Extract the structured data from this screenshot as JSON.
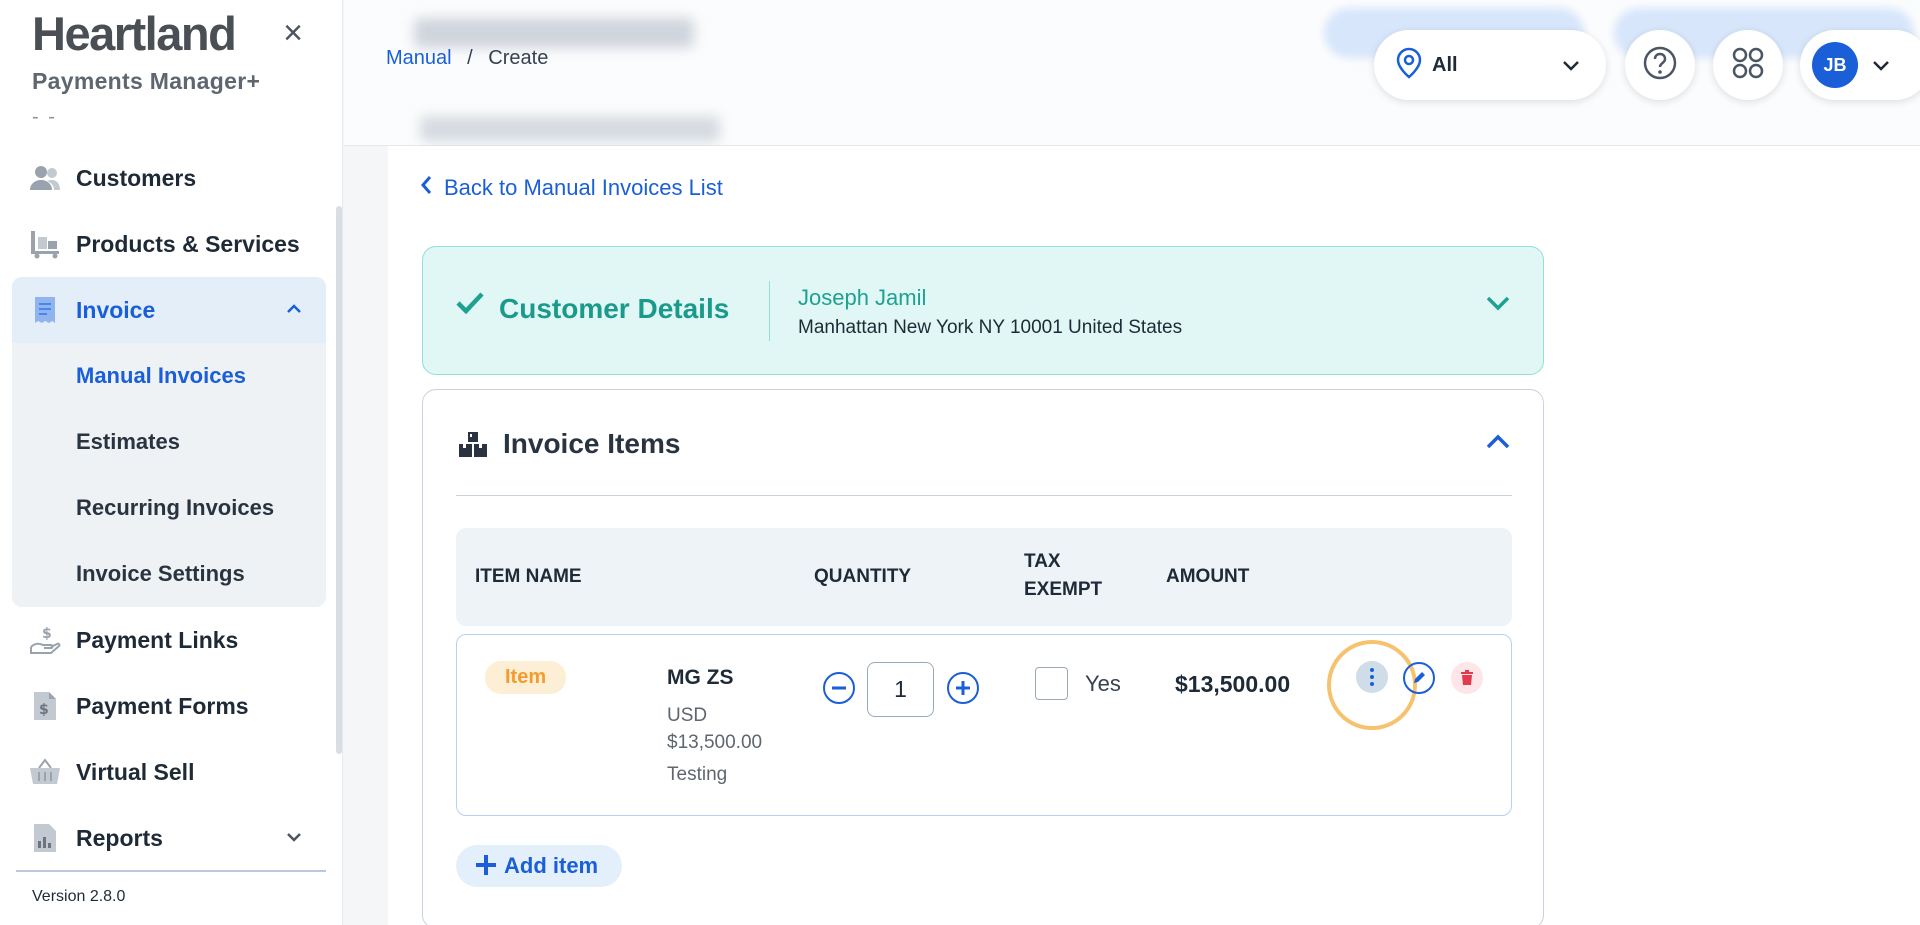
{
  "brand": {
    "name": "Heartland",
    "subtitle": "Payments Manager+",
    "dashes": "- -"
  },
  "sidebar": {
    "items": [
      {
        "label": "Customers",
        "icon": "users-icon"
      },
      {
        "label": "Products & Services",
        "icon": "products-icon"
      },
      {
        "label": "Invoice",
        "icon": "receipt-icon",
        "expanded": true,
        "children": [
          {
            "label": "Manual Invoices",
            "current": true
          },
          {
            "label": "Estimates"
          },
          {
            "label": "Recurring Invoices"
          },
          {
            "label": "Invoice Settings"
          }
        ]
      },
      {
        "label": "Payment Links",
        "icon": "hand-dollar-icon"
      },
      {
        "label": "Payment Forms",
        "icon": "dollar-document-icon"
      },
      {
        "label": "Virtual Sell",
        "icon": "basket-icon"
      },
      {
        "label": "Reports",
        "icon": "report-icon"
      }
    ],
    "version": "Version 2.8.0"
  },
  "breadcrumb": {
    "link": "Manual",
    "separator": "/",
    "current": "Create"
  },
  "header": {
    "location_label": "All",
    "avatar_initials": "JB"
  },
  "back_link": "Back to Manual Invoices List",
  "customer": {
    "title": "Customer Details",
    "name": "Joseph Jamil",
    "address": "Manhattan New York NY 10001 United States"
  },
  "invoice_items": {
    "title": "Invoice Items",
    "columns": [
      "ITEM NAME",
      "QUANTITY",
      "TAX EXEMPT",
      "AMOUNT"
    ],
    "rows": [
      {
        "type_badge": "Item",
        "name": "MG ZS",
        "currency": "USD",
        "price": "$13,500.00",
        "description": "Testing",
        "quantity": "1",
        "tax_exempt_label": "Yes",
        "tax_exempt_checked": false,
        "amount": "$13,500.00"
      }
    ],
    "add_label": "Add item"
  },
  "colors": {
    "primary": "#1a5fd8",
    "teal": "#1fa191",
    "badge": "#f39c2e",
    "highlight": "#f6c26e"
  }
}
